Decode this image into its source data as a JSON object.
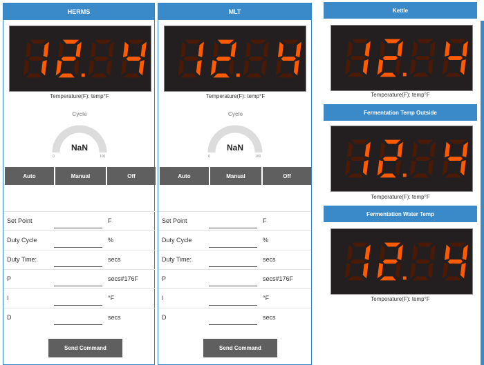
{
  "accent_color": "#3a89c9",
  "display_bg": "#231f20",
  "segment_on_color": "#ff5a00",
  "segment_off_color": "#4a1a06",
  "panels": [
    {
      "title": "HERMS",
      "display": "12.4",
      "caption": "Temperature(F): temp°F",
      "cycle": {
        "title": "Cycle",
        "value": "NaN",
        "min": "0",
        "max": "100"
      },
      "modes": [
        "Auto",
        "Manual",
        "Off"
      ],
      "fields": [
        {
          "label": "Set Point",
          "value": "",
          "unit": "F"
        },
        {
          "label": "Duty Cycle",
          "value": "",
          "unit": "%"
        },
        {
          "label": "Duty Time:",
          "value": "",
          "unit": "secs"
        },
        {
          "label": "P",
          "value": "",
          "unit": "secs#176F"
        },
        {
          "label": "I",
          "value": "",
          "unit": "°F"
        },
        {
          "label": "D",
          "value": "",
          "unit": "secs"
        }
      ],
      "send_label": "Send Command"
    },
    {
      "title": "MLT",
      "display": "12.4",
      "caption": "Temperature(F): temp°F",
      "cycle": {
        "title": "Cycle",
        "value": "NaN",
        "min": "0",
        "max": "100"
      },
      "modes": [
        "Auto",
        "Manual",
        "Off"
      ],
      "fields": [
        {
          "label": "Set Point",
          "value": "",
          "unit": "F"
        },
        {
          "label": "Duty Cycle",
          "value": "",
          "unit": "%"
        },
        {
          "label": "Duty Time:",
          "value": "",
          "unit": "secs"
        },
        {
          "label": "P",
          "value": "",
          "unit": "secs#176F"
        },
        {
          "label": "I",
          "value": "",
          "unit": "°F"
        },
        {
          "label": "D",
          "value": "",
          "unit": "secs"
        }
      ],
      "send_label": "Send Command"
    }
  ],
  "right": [
    {
      "title": "Kettle",
      "display": "12.4",
      "caption": "Temperature(F): temp°F"
    },
    {
      "title": "Fermentation Temp Outside",
      "display": "12.4",
      "caption": "Temperature(F): temp°F"
    },
    {
      "title": "Fermentation Water Temp",
      "display": "12.4",
      "caption": "Temperature(F): temp°F"
    }
  ]
}
